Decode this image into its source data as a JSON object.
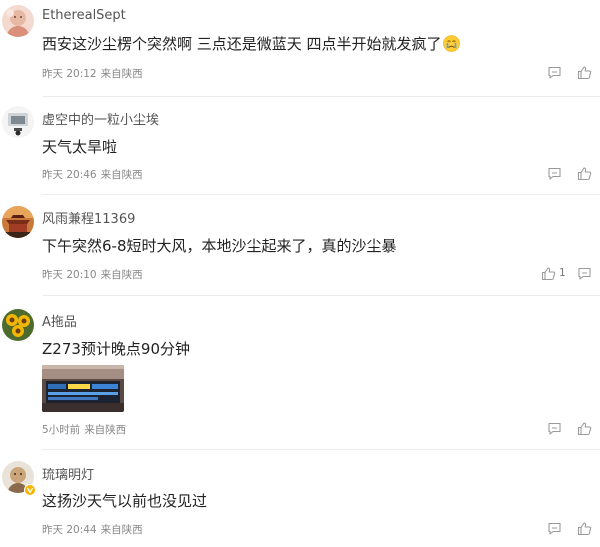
{
  "comments": [
    {
      "username": "EtherealSept",
      "content": "西安这沙尘楞个突然啊 三点还是微蓝天 四点半开始就发疯了",
      "emoji": "crying-face-emoji",
      "time": "昨天 20:12",
      "location": "来自陕西",
      "likes": ""
    },
    {
      "username": "虚空中的一粒小尘埃",
      "content": "天气太旱啦",
      "time": "昨天 20:46",
      "location": "来自陕西",
      "likes": ""
    },
    {
      "username": "风雨兼程11369",
      "content": "下午突然6-8短时大风，本地沙尘起来了，真的沙尘暴",
      "time": "昨天 20:10",
      "location": "来自陕西",
      "likes": "1"
    },
    {
      "username": "A拖品",
      "content": "Z273预计晚点90分钟",
      "image": "station-departure-board-photo",
      "time": "5小时前",
      "location": "来自陕西",
      "likes": ""
    },
    {
      "username": "琉璃明灯",
      "content": "这扬沙天气以前也没见过",
      "time": "昨天 20:44",
      "location": "来自陕西",
      "likes": ""
    }
  ],
  "icons": {
    "like": "thumbs-up-icon",
    "comment": "comment-bubble-icon",
    "badge": "gold-v-badge-icon"
  },
  "colors": {
    "username": "#555555",
    "content": "#222222",
    "meta": "#888888",
    "icon": "#9a9a9a",
    "badge": "#f5b400"
  }
}
